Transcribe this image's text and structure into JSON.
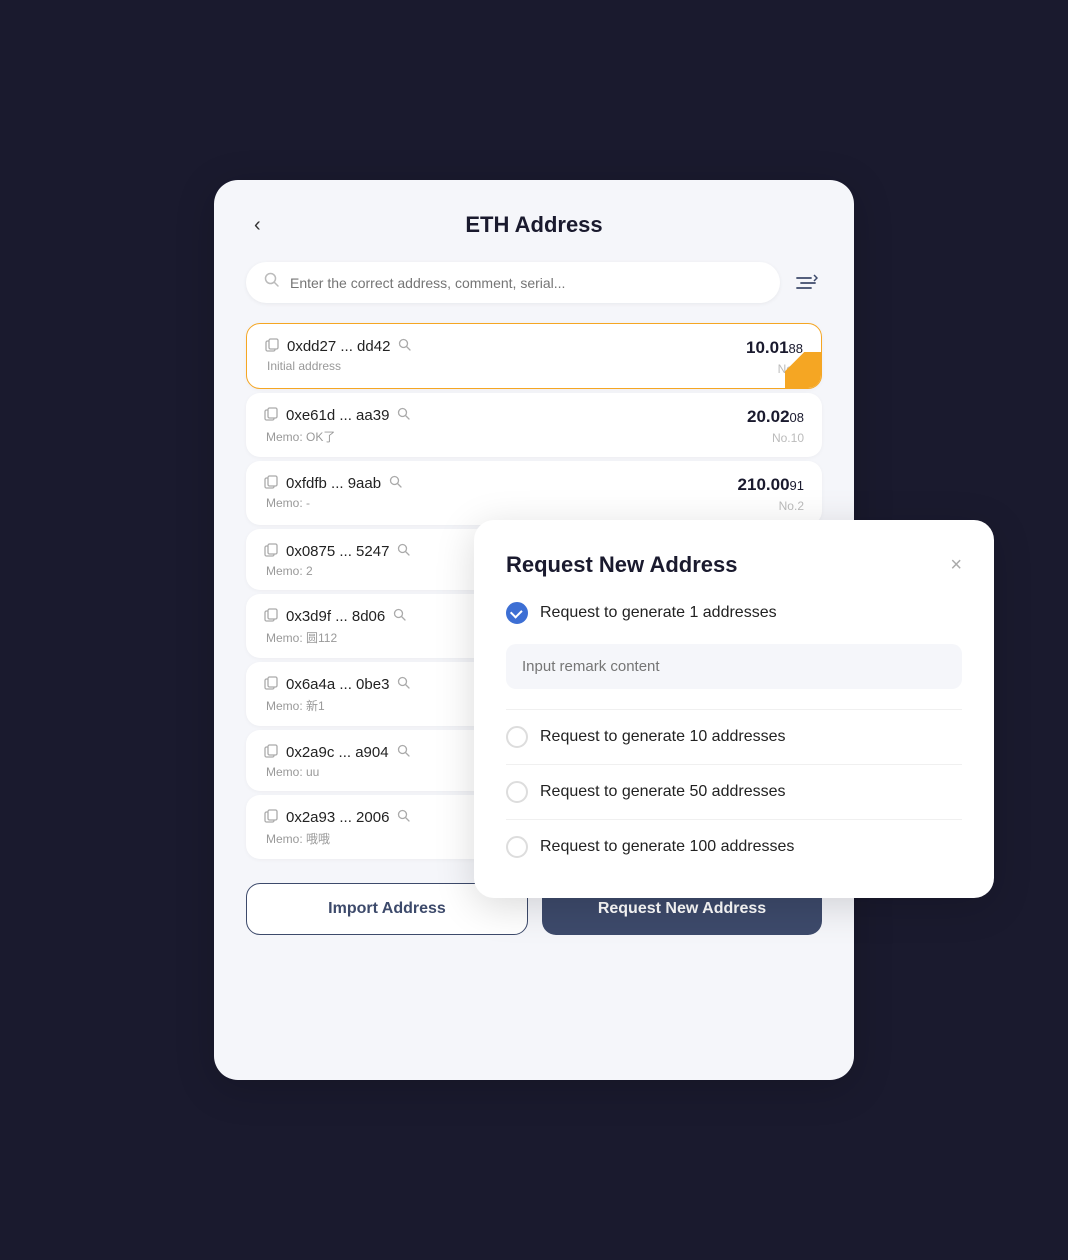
{
  "header": {
    "back_label": "‹",
    "title": "ETH Address"
  },
  "search": {
    "placeholder": "Enter the correct address, comment, serial..."
  },
  "filter_icon": "≡↕",
  "addresses": [
    {
      "address": "0xdd27 ... dd42",
      "memo": "Initial address",
      "balance_main": "10.01",
      "balance_small": "88",
      "no": "No.0",
      "active": true
    },
    {
      "address": "0xe61d ... aa39",
      "memo": "Memo: OK了",
      "balance_main": "20.02",
      "balance_small": "08",
      "no": "No.10",
      "active": false
    },
    {
      "address": "0xfdfb ... 9aab",
      "memo": "Memo: -",
      "balance_main": "210.00",
      "balance_small": "91",
      "no": "No.2",
      "active": false
    },
    {
      "address": "0x0875 ... 5247",
      "memo": "Memo: 2",
      "balance_main": "",
      "balance_small": "",
      "no": "",
      "active": false
    },
    {
      "address": "0x3d9f ... 8d06",
      "memo": "Memo: 圆112",
      "balance_main": "",
      "balance_small": "",
      "no": "",
      "active": false
    },
    {
      "address": "0x6a4a ... 0be3",
      "memo": "Memo: 新1",
      "balance_main": "",
      "balance_small": "",
      "no": "",
      "active": false
    },
    {
      "address": "0x2a9c ... a904",
      "memo": "Memo: uu",
      "balance_main": "",
      "balance_small": "",
      "no": "",
      "active": false
    },
    {
      "address": "0x2a93 ... 2006",
      "memo": "Memo: 哦哦",
      "balance_main": "",
      "balance_small": "",
      "no": "",
      "active": false
    }
  ],
  "footer": {
    "import_label": "Import Address",
    "request_label": "Request New Address"
  },
  "modal": {
    "title": "Request New Address",
    "close_label": "×",
    "options": [
      {
        "label": "Request to generate 1 addresses",
        "checked": true
      },
      {
        "label": "Request to generate 10 addresses",
        "checked": false
      },
      {
        "label": "Request to generate 50 addresses",
        "checked": false
      },
      {
        "label": "Request to generate 100 addresses",
        "checked": false
      }
    ],
    "remark_placeholder": "Input remark content"
  }
}
